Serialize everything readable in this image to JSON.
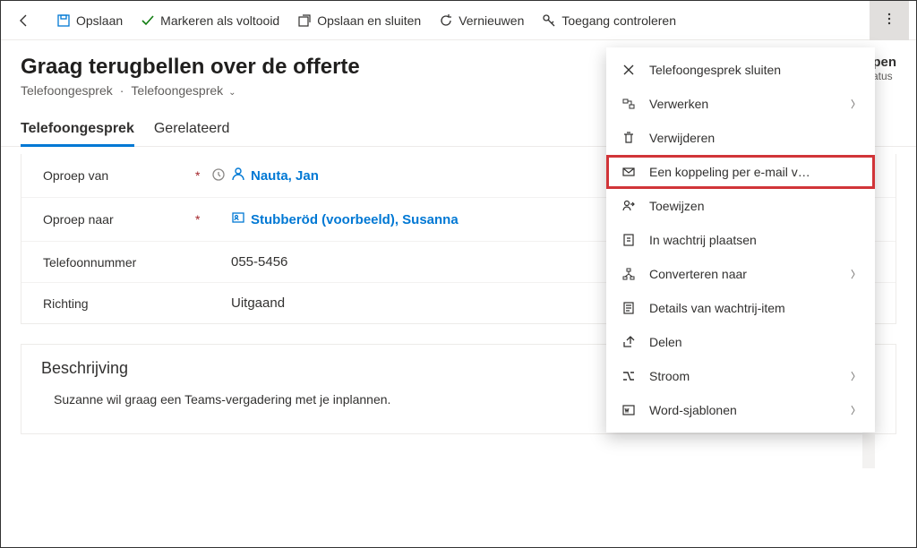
{
  "toolbar": {
    "save": "Opslaan",
    "markComplete": "Markeren als voltooid",
    "saveClose": "Opslaan en sluiten",
    "refresh": "Vernieuwen",
    "checkAccess": "Toegang controleren"
  },
  "header": {
    "title": "Graag terugbellen over de offerte",
    "entity": "Telefoongesprek",
    "formName": "Telefoongesprek",
    "statusValue": "Open",
    "statusLabel": "Status"
  },
  "tabs": {
    "phone": "Telefoongesprek",
    "related": "Gerelateerd"
  },
  "fields": {
    "callFrom": {
      "label": "Oproep van",
      "value": "Nauta, Jan"
    },
    "callTo": {
      "label": "Oproep naar",
      "value": "Stubberöd (voorbeeld), Susanna"
    },
    "phoneNumber": {
      "label": "Telefoonnummer",
      "value": "055-5456"
    },
    "direction": {
      "label": "Richting",
      "value": "Uitgaand"
    }
  },
  "description": {
    "title": "Beschrijving",
    "text": "Suzanne wil graag een Teams-vergadering met je inplannen."
  },
  "menu": {
    "close": "Telefoongesprek sluiten",
    "process": "Verwerken",
    "delete": "Verwijderen",
    "emailLink": "Een koppeling per e-mail v…",
    "assign": "Toewijzen",
    "queue": "In wachtrij plaatsen",
    "convert": "Converteren naar",
    "queueDetails": "Details van wachtrij-item",
    "share": "Delen",
    "flow": "Stroom",
    "wordTemplates": "Word-sjablonen"
  }
}
